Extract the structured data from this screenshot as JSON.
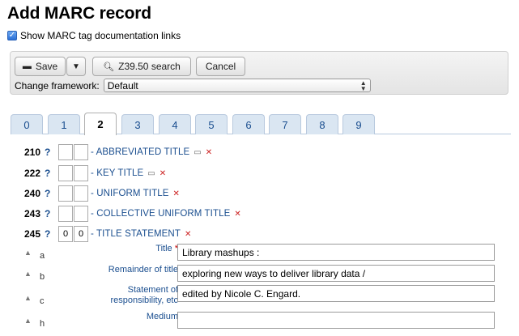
{
  "page": {
    "title": "Add MARC record"
  },
  "doc_links": {
    "checked": true,
    "label": "Show MARC tag documentation links"
  },
  "toolbar": {
    "save_label": "Save",
    "z3950_label": "Z39.50 search",
    "cancel_label": "Cancel",
    "framework_label": "Change framework:",
    "framework_value": "Default"
  },
  "tabs": [
    {
      "label": "0"
    },
    {
      "label": "1"
    },
    {
      "label": "2",
      "active": true
    },
    {
      "label": "3"
    },
    {
      "label": "4"
    },
    {
      "label": "5"
    },
    {
      "label": "6"
    },
    {
      "label": "7"
    },
    {
      "label": "8"
    },
    {
      "label": "9"
    }
  ],
  "fields": [
    {
      "tag": "210",
      "help": "?",
      "ind1": "",
      "ind2": "",
      "title": "- ABBREVIATED TITLE"
    },
    {
      "tag": "222",
      "help": "?",
      "ind1": "",
      "ind2": "",
      "title": "- KEY TITLE"
    },
    {
      "tag": "240",
      "help": "?",
      "ind1": "",
      "ind2": "",
      "title": "- UNIFORM TITLE"
    },
    {
      "tag": "243",
      "help": "?",
      "ind1": "",
      "ind2": "",
      "title": "- COLLECTIVE UNIFORM TITLE"
    },
    {
      "tag": "245",
      "help": "?",
      "ind1": "0",
      "ind2": "0",
      "title": "- TITLE STATEMENT"
    }
  ],
  "subfields": [
    {
      "code": "a",
      "label": "Title",
      "required": "*",
      "value": "Library mashups :"
    },
    {
      "code": "b",
      "label": "Remainder of title",
      "required": "",
      "value": "exploring new ways to deliver library data /"
    },
    {
      "code": "c",
      "label": "Statement of responsibility, etc",
      "required": "",
      "value": "edited by Nicole C. Engard."
    },
    {
      "code": "h",
      "label": "Medium",
      "required": "",
      "value": ""
    }
  ]
}
